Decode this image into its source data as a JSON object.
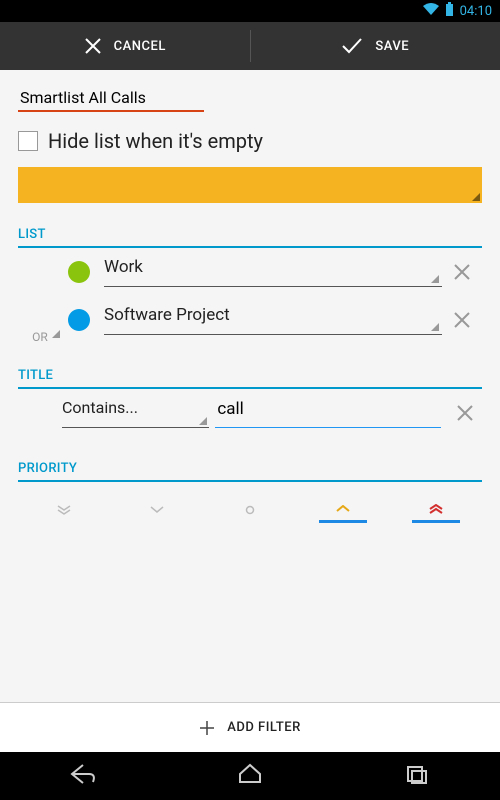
{
  "statusbar": {
    "time": "04:10"
  },
  "actionbar": {
    "cancel": "CANCEL",
    "save": "SAVE"
  },
  "main": {
    "name": "Smartlist All Calls",
    "hide_checkbox_label": "Hide list when it's empty",
    "colorbar": "#f6b321"
  },
  "sections": {
    "list_header": "LIST",
    "title_header": "TITLE",
    "priority_header": "PRIORITY"
  },
  "list_filters": [
    {
      "op": "",
      "color": "green",
      "label": "Work"
    },
    {
      "op": "OR",
      "color": "blue",
      "label": "Software Project"
    }
  ],
  "title_filter": {
    "operator": "Contains...",
    "value": "call"
  },
  "priority": {
    "options": [
      "lowest",
      "low",
      "none",
      "high",
      "highest"
    ],
    "selected": [
      "high",
      "highest"
    ]
  },
  "footer": {
    "add_filter": "ADD FILTER"
  }
}
